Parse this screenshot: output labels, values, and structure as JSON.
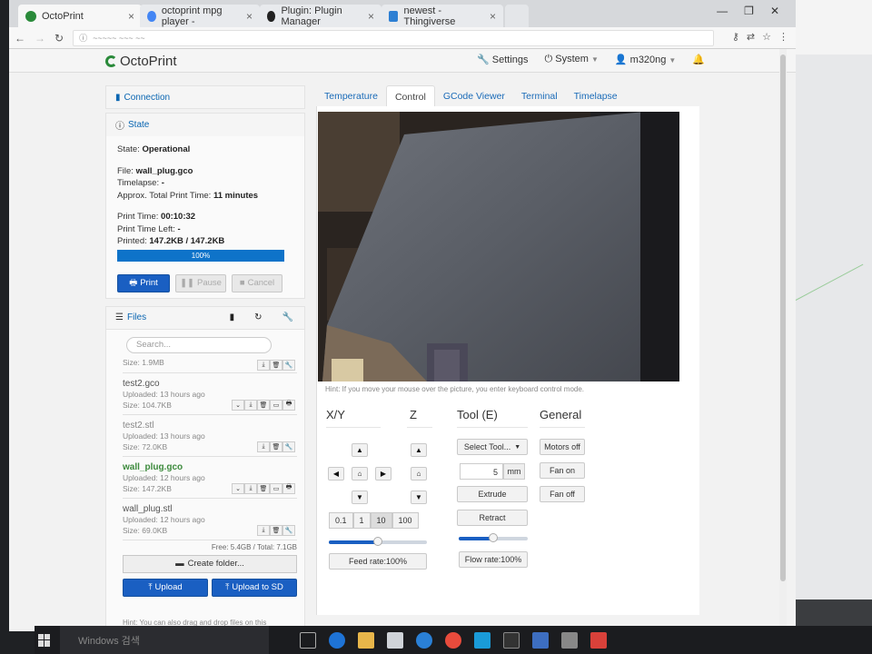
{
  "browser": {
    "tabs": [
      {
        "label": "OctoPrint",
        "favicon_color": "#2a8a3a"
      },
      {
        "label": "octoprint mpg player -",
        "favicon_color": "#4285f4"
      },
      {
        "label": "Plugin: Plugin Manager",
        "favicon_color": "#222222"
      },
      {
        "label": "newest - Thingiverse",
        "favicon_color": "#2d7fd3"
      }
    ],
    "url": "~~~~~ ~~~ ~~"
  },
  "navbar": {
    "brand": "OctoPrint",
    "settings": "Settings",
    "system": "System",
    "user": "m320ng"
  },
  "sidebar": {
    "connection_title": "Connection",
    "state_title": "State",
    "state": {
      "state_label": "State:",
      "state_value": "Operational",
      "file_label": "File:",
      "file_value": "wall_plug.gco",
      "timelapse_label": "Timelapse:",
      "timelapse_value": "-",
      "approx_label": "Approx. Total Print Time:",
      "approx_value": "11 minutes",
      "print_time_label": "Print Time:",
      "print_time_value": "00:10:32",
      "time_left_label": "Print Time Left:",
      "time_left_value": "-",
      "printed_label": "Printed:",
      "printed_value": "147.2KB / 147.2KB",
      "progress_text": "100%",
      "progress": 1.0
    },
    "buttons": {
      "print": "Print",
      "pause": "Pause",
      "cancel": "Cancel"
    },
    "files_title": "Files",
    "search_placeholder": "Search...",
    "top_size": "Size: 1.9MB",
    "files": [
      {
        "name": "test2.gco",
        "uploaded": "Uploaded: 13 hours ago",
        "size": "Size: 104.7KB",
        "active": false
      },
      {
        "name": "test2.stl",
        "uploaded": "Uploaded: 13 hours ago",
        "size": "Size: 72.0KB",
        "active": false
      },
      {
        "name": "wall_plug.gco",
        "uploaded": "Uploaded: 12 hours ago",
        "size": "Size: 147.2KB",
        "active": true
      },
      {
        "name": "wall_plug.stl",
        "uploaded": "Uploaded: 12 hours ago",
        "size": "Size: 69.0KB",
        "active": false
      }
    ],
    "free_info": "Free: 5.4GB / Total: 7.1GB",
    "create_folder": "Create folder...",
    "upload": "Upload",
    "upload_sd": "Upload to SD",
    "hint": "Hint: You can also drag and drop files on this"
  },
  "main": {
    "tabs": [
      "Temperature",
      "Control",
      "GCode Viewer",
      "Terminal",
      "Timelapse"
    ],
    "active_tab": "Control",
    "webcam_hint": "Hint: If you move your mouse over the picture, you enter keyboard control mode.",
    "headers": {
      "xy": "X/Y",
      "z": "Z",
      "tool": "Tool (E)",
      "general": "General"
    },
    "steps": [
      "0.1",
      "1",
      "10",
      "100"
    ],
    "active_step": "10",
    "feed_rate": "Feed rate:100%",
    "feed_rate_level": 0.5,
    "tool": {
      "select": "Select Tool...",
      "amount": "5",
      "unit": "mm",
      "extrude": "Extrude",
      "retract": "Retract",
      "flow_rate": "Flow rate:100%",
      "flow_rate_level": 0.5
    },
    "general": {
      "motors_off": "Motors off",
      "fan_on": "Fan on",
      "fan_off": "Fan off"
    }
  },
  "taskbar": {
    "search": "Windows 검색"
  },
  "colors": {
    "primary": "#1a5fc2",
    "link": "#0a66b2",
    "active_file": "#3c8a3c",
    "brand_green": "#2a8a3a"
  }
}
